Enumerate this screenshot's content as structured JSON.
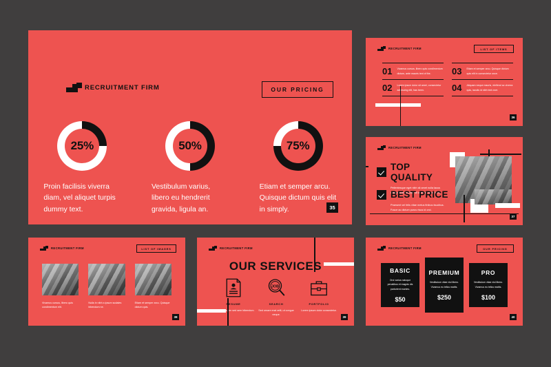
{
  "theme": {
    "background": "#403E3E",
    "slide_bg": "#EE5350",
    "ink": "#111111",
    "light": "#FFFFFF"
  },
  "brand": {
    "name": "RECRUITMENT FIRM"
  },
  "slide_pricing_hero": {
    "tag_label": "OUR PRICING",
    "page": "35",
    "stats": [
      {
        "percent": "25%",
        "value": 25,
        "caption": "Proin facilisis viverra diam, vel aliquet turpis dummy text."
      },
      {
        "percent": "50%",
        "value": 50,
        "caption": "Vestibulum varius, libero eu hendrerit gravida, ligula an."
      },
      {
        "percent": "75%",
        "value": 75,
        "caption": "Etiam et semper arcu. Quisque dictum quis elit in simply."
      }
    ]
  },
  "slide_list_items": {
    "tag_label": "LIST OF ITEMS",
    "page": "36",
    "items_left": [
      {
        "num": "01",
        "text": "Vivamus cursus, libero quis condimentum dictum, ante mauris text of the."
      },
      {
        "num": "02",
        "text": "Lorem ipsum dolor sit amet, consectetur adipiscing elit, has been."
      }
    ],
    "items_right": [
      {
        "num": "03",
        "text": "Etiam et semper arcu. Quisque dictum quis elit in consectetur once."
      },
      {
        "num": "04",
        "text": "Aliquam neque mauris, eleifend ac viverra quis, iaculis id nibh text over."
      }
    ]
  },
  "slide_quality": {
    "page": "37",
    "features": [
      {
        "title": "TOP QUALITY",
        "body": "Pellentesque eget nibh sit amet nulla lacus ullamcorper pulvinar sit amet sit amet in mi."
      },
      {
        "title": "BEST PRICE",
        "body": "Praesent vel felis vitae metus finibus faucibus. Fusce ac dictum purus risus id orci."
      }
    ]
  },
  "slide_images": {
    "tag_label": "LIST OF IMAGES",
    "page": "38",
    "images": [
      {
        "caption": "Vivamus cursus, libero quis condimentum elit."
      },
      {
        "caption": "Nulla in nibh a ipsum sodales bibendum ne."
      },
      {
        "caption": "Etiam et semper arcu. Quisque dictum quis."
      }
    ]
  },
  "slide_services": {
    "title": "OUR SERVICES",
    "page": "39",
    "services": [
      {
        "icon": "resume-icon",
        "name": "RESUME",
        "body": "Donec eu sapien sed sem bibendum."
      },
      {
        "icon": "job-search-icon",
        "name": "SEARCH",
        "body": "Sed ornare erat velit, ut congue neque."
      },
      {
        "icon": "portfolio-briefcase-icon",
        "name": "PORTFOLIO",
        "body": "Lorem ipsum dolor consectetur."
      }
    ]
  },
  "slide_pricing_plans": {
    "tag_label": "OUR PRICING",
    "page": "40",
    "plans": [
      {
        "name": "BASIC",
        "desc": "Orci varius natoque penatibus et magnis dis parturient montes.",
        "price": "$50",
        "featured": false
      },
      {
        "name": "PREMIUM",
        "desc": "Vestibulum vitae nisl libero. Vivamus eu tellus mattis.",
        "price": "$250",
        "featured": true
      },
      {
        "name": "PRO",
        "desc": "Vestibulum vitae nisl libero. Vivamus eu tellus mattis.",
        "price": "$100",
        "featured": false
      }
    ]
  }
}
